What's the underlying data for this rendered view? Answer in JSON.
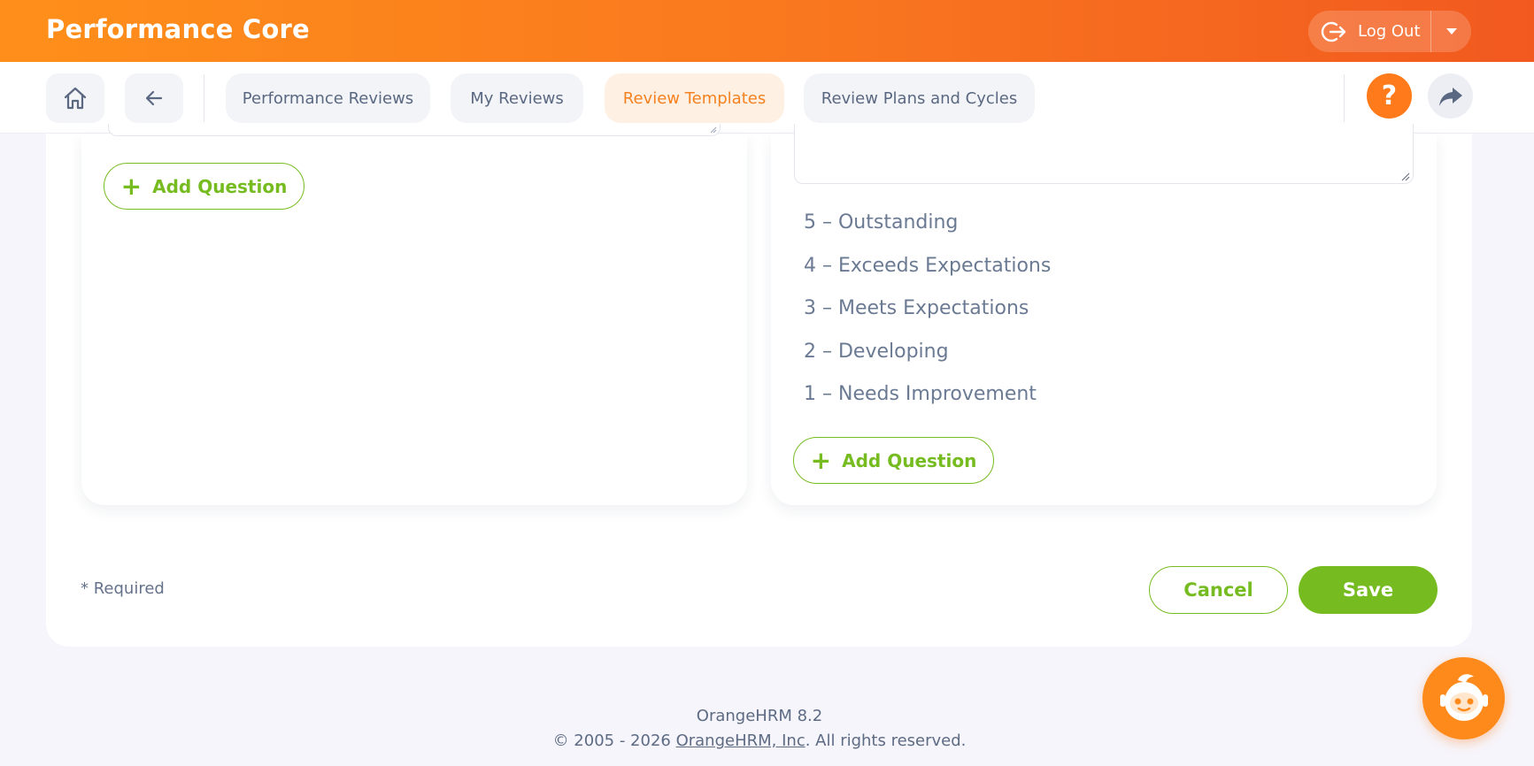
{
  "header": {
    "title": "Performance Core",
    "logout_label": "Log Out"
  },
  "nav": {
    "tabs": [
      {
        "label": "Performance Reviews",
        "active": false
      },
      {
        "label": "My Reviews",
        "active": false
      },
      {
        "label": "Review Templates",
        "active": true
      },
      {
        "label": "Review Plans and Cycles",
        "active": false
      }
    ],
    "help_label": "?"
  },
  "form": {
    "left_panel": {
      "add_question_label": "Add Question"
    },
    "right_panel": {
      "rating_scale": [
        "5 – Outstanding",
        "4 – Exceeds Expectations",
        "3 – Meets Expectations",
        "2 – Developing",
        "1 – Needs Improvement"
      ],
      "add_question_label": "Add Question"
    },
    "required_note": "* Required",
    "cancel_label": "Cancel",
    "save_label": "Save"
  },
  "footer": {
    "version": "OrangeHRM 8.2",
    "copyright_prefix": "© 2005 - 2026 ",
    "company_link": "OrangeHRM, Inc",
    "copyright_suffix": ". All rights reserved."
  },
  "colors": {
    "brand_orange": "#f58220",
    "action_green": "#76bc21",
    "text_gray": "#64728c"
  }
}
